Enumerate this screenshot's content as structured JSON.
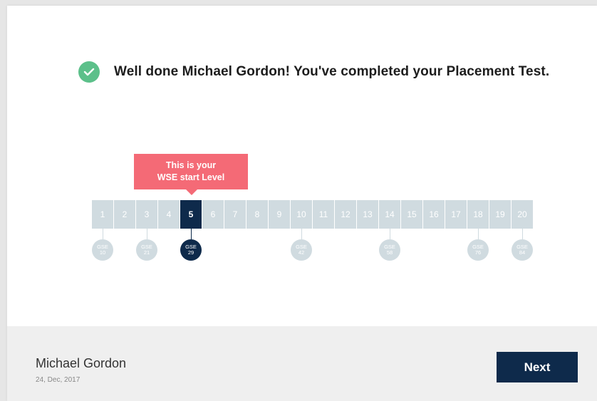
{
  "header": {
    "message": "Well done Michael Gordon! You've completed your Placement Test."
  },
  "callout": {
    "line1": "This is your",
    "line2": "WSE start Level"
  },
  "levels": [
    "1",
    "2",
    "3",
    "4",
    "5",
    "6",
    "7",
    "8",
    "9",
    "10",
    "11",
    "12",
    "13",
    "14",
    "15",
    "16",
    "17",
    "18",
    "19",
    "20"
  ],
  "current_level": "5",
  "gse_markers": [
    {
      "label": "GSE",
      "value": "10",
      "level": "1"
    },
    {
      "label": "GSE",
      "value": "21",
      "level": "3"
    },
    {
      "label": "GSE",
      "value": "29",
      "level": "5"
    },
    {
      "label": "GSE",
      "value": "42",
      "level": "10"
    },
    {
      "label": "GSE",
      "value": "58",
      "level": "14"
    },
    {
      "label": "GSE",
      "value": "76",
      "level": "18"
    },
    {
      "label": "GSE",
      "value": "84",
      "level": "20"
    }
  ],
  "footer": {
    "user_name": "Michael Gordon",
    "date": "24, Dec, 2017",
    "next_label": "Next"
  },
  "colors": {
    "accent_navy": "#0e2a4b",
    "callout_pink": "#f46a76",
    "success_green": "#5cc08a",
    "inactive_level": "#d0dbe0"
  },
  "icons": {
    "check": "check-icon"
  }
}
